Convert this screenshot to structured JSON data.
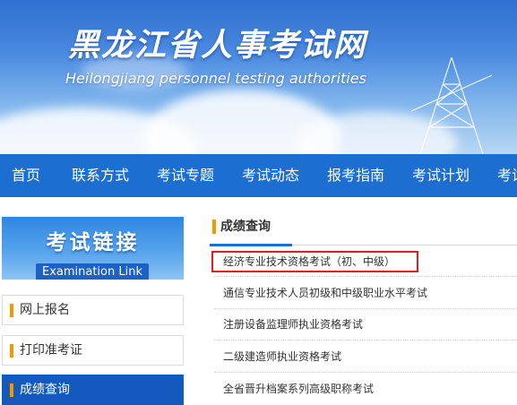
{
  "header": {
    "title": "黑龙江省人事考试网",
    "subtitle": "Heilongjiang personnel testing authorities"
  },
  "nav": {
    "items": [
      {
        "label": "首页"
      },
      {
        "label": "联系方式"
      },
      {
        "label": "考试专题"
      },
      {
        "label": "考试动态"
      },
      {
        "label": "报考指南"
      },
      {
        "label": "考试计划"
      },
      {
        "label": "考试"
      }
    ],
    "color": "#1c6fd0"
  },
  "sidebar": {
    "banner_title": "考试链接",
    "banner_subtitle": "Examination Link",
    "items": [
      {
        "label": "网上报名",
        "active": false
      },
      {
        "label": "打印准考证",
        "active": false
      },
      {
        "label": "成绩查询",
        "active": true
      }
    ],
    "active_color": "#1359be",
    "bar_color": "#f39800"
  },
  "main": {
    "section_title": "成绩查询",
    "links": [
      {
        "label": "经济专业技术资格考试（初、中级）",
        "highlighted": true
      },
      {
        "label": "通信专业技术人员初级和中级职业水平考试",
        "highlighted": false
      },
      {
        "label": "注册设备监理师执业资格考试",
        "highlighted": false
      },
      {
        "label": "二级建造师执业资格考试",
        "highlighted": false
      },
      {
        "label": "全省晋升档案系列高级职称考试",
        "highlighted": false
      }
    ],
    "highlight_color": "#e02020"
  }
}
